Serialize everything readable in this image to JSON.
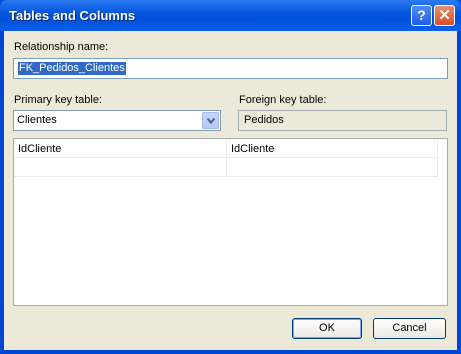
{
  "window": {
    "title": "Tables and Columns",
    "help_glyph": "?",
    "close_glyph": "✕"
  },
  "relationship": {
    "label": "Relationship name:",
    "value": "FK_Pedidos_Clientes"
  },
  "primary_key": {
    "label": "Primary key table:",
    "value": "Clientes"
  },
  "foreign_key": {
    "label": "Foreign key table:",
    "value": "Pedidos"
  },
  "columns_grid": {
    "rows": [
      {
        "primary": "IdCliente",
        "foreign": "IdCliente"
      },
      {
        "primary": "",
        "foreign": ""
      }
    ]
  },
  "buttons": {
    "ok": "OK",
    "cancel": "Cancel"
  },
  "colors": {
    "titlebar": "#0054e3",
    "dialog_bg": "#ece9d8",
    "selection": "#316ac5"
  },
  "icons": {
    "combo_arrow": "chevron-down-icon"
  }
}
